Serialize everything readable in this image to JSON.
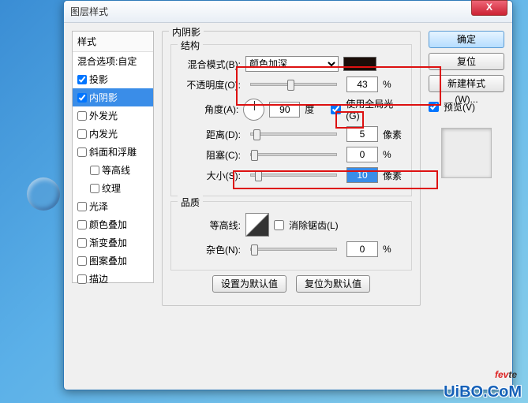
{
  "window": {
    "title": "图层样式",
    "close": "X"
  },
  "left": {
    "header": "样式",
    "blend": "混合选项:自定",
    "items": [
      {
        "label": "投影",
        "checked": true
      },
      {
        "label": "内阴影",
        "checked": true,
        "selected": true
      },
      {
        "label": "外发光",
        "checked": false
      },
      {
        "label": "内发光",
        "checked": false
      },
      {
        "label": "斜面和浮雕",
        "checked": false
      },
      {
        "label": "等高线",
        "checked": false,
        "indent": true
      },
      {
        "label": "纹理",
        "checked": false,
        "indent": true
      },
      {
        "label": "光泽",
        "checked": false
      },
      {
        "label": "颜色叠加",
        "checked": false
      },
      {
        "label": "渐变叠加",
        "checked": false
      },
      {
        "label": "图案叠加",
        "checked": false
      },
      {
        "label": "描边",
        "checked": false
      }
    ]
  },
  "mid": {
    "title": "内阴影",
    "structure": {
      "legend": "结构",
      "blendmode_label": "混合模式(B):",
      "blendmode_value": "颜色加深",
      "opacity_label": "不透明度(O):",
      "opacity_value": "43",
      "percent": "%",
      "angle_label": "角度(A):",
      "angle_value": "90",
      "degree": "度",
      "global_label": "使用全局光(G)",
      "distance_label": "距离(D):",
      "distance_value": "5",
      "px": "像素",
      "choke_label": "阻塞(C):",
      "choke_value": "0",
      "size_label": "大小(S):",
      "size_value": "10"
    },
    "quality": {
      "legend": "品质",
      "contour_label": "等高线:",
      "aa_label": "消除锯齿(L)",
      "noise_label": "杂色(N):",
      "noise_value": "0"
    },
    "defaults": {
      "set": "设置为默认值",
      "reset": "复位为默认值"
    }
  },
  "right": {
    "ok": "确定",
    "cancel": "复位",
    "newstyle": "新建样式(W)...",
    "preview_label": "预览(V)"
  },
  "watermark": {
    "fev": "fev",
    "te": "te",
    ".com": ".com",
    "uibo": "UiBO.CoM"
  }
}
